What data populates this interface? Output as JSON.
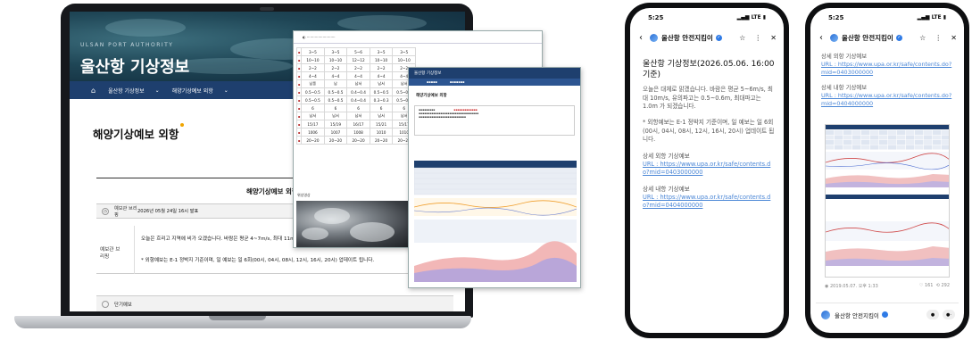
{
  "laptop": {
    "header": {
      "brand_en": "ULSAN PORT AUTHORITY",
      "brand_ko": "울산항 기상정보"
    },
    "nav": {
      "crumb1": "울산항 기상정보",
      "crumb2": "해양기상예보 외항"
    },
    "page_title": "해양기상예보 외항",
    "sub_title": "해양기상예보 외항",
    "issued": {
      "label": "예보관 브리핑",
      "value": "2026년 05월 24일 16시 발표"
    },
    "briefing": {
      "label": "예보관 브리핑",
      "line1": "오늘은 흐리고 지역에 비가 오겠습니다. 바람은 평균 4~7m/s, 최대 11m/s, 유의파",
      "line2": "* 외항예보는 E-1 정박지 기준이며, 일 예보는 일 6회(00시, 04시, 08시, 12시, 16시, 20시) 업데이트 됩니다."
    },
    "short_forecast": "단기예보",
    "overlay1": {
      "rows": [
        [
          "3~5",
          "3~5",
          "5~6",
          "3~5",
          "3~5"
        ],
        [
          "10~10",
          "10~10",
          "12~12",
          "10~10",
          "10~10"
        ],
        [
          "2~2",
          "2~2",
          "2~2",
          "2~2",
          "2~2"
        ],
        [
          "4~4",
          "4~4",
          "4~4",
          "4~4",
          "4~4"
        ],
        [
          "남풍",
          "남",
          "남서",
          "남서",
          "남서"
        ],
        [
          "0.5~0.5",
          "0.5~0.5",
          "0.4~0.4",
          "0.5~0.5",
          "0.5~0.5"
        ],
        [
          "0.5~0.5",
          "0.5~0.5",
          "0.4~0.4",
          "0.3~0.3",
          "0.5~0.5"
        ],
        [
          "6",
          "6",
          "6",
          "6",
          "6"
        ],
        [
          "남서",
          "남서",
          "남서",
          "남서",
          "남서"
        ],
        [
          "15/17",
          "15/19",
          "16/17",
          "15/21",
          "15/17"
        ],
        [
          "1006",
          "1007",
          "1008",
          "1010",
          "1010"
        ],
        [
          "20~20",
          "20~20",
          "20~20",
          "20~20",
          "20~20"
        ]
      ],
      "satellite_label": "위성영상"
    },
    "overlay2": {
      "header": "울산항 기상정보",
      "title": "해양기상예보 외항"
    }
  },
  "phone1": {
    "time": "5:25",
    "signal": "LTE",
    "channel": "울산항 안전지킴이",
    "headline": "울산항 기상정보(2026.05.06. 16:00 기준)",
    "p1": "오늘은 대체로 맑겠습니다. 바람은 평균 5~6m/s, 최대 10m/s, 유의파고는 0.5~0.6m, 최대파고는 1.0m 가 되겠습니다.",
    "p2": "* 외항예보는 E-1 정박지 기준이며, 일 예보는 일 6회(00시, 04시, 08시, 12시, 16시, 20시) 업데이트 됩니다.",
    "outer_label": "상세 외항 기상예보",
    "outer_url": "URL : https://www.upa.or.kr/safe/contents.do?mid=0403000000",
    "inner_label": "상세 내항 기상예보",
    "inner_url": "URL : https://www.upa.or.kr/safe/contents.do?mid=0404000000"
  },
  "phone2": {
    "time": "5:25",
    "signal": "LTE",
    "channel": "울산항 안전지킴이",
    "outer_label": "상세 외항 기상예보",
    "outer_url": "URL : https://www.upa.or.kr/safe/contents.do?mid=0403000000",
    "inner_label": "상세 내항 기상예보",
    "inner_url": "URL : https://www.upa.or.kr/safe/contents.do?mid=0404000000",
    "date": "2019.05.07. 오후 1:33",
    "likes": "161",
    "shares": "292",
    "footer_channel": "울산항 안전지킴이"
  }
}
